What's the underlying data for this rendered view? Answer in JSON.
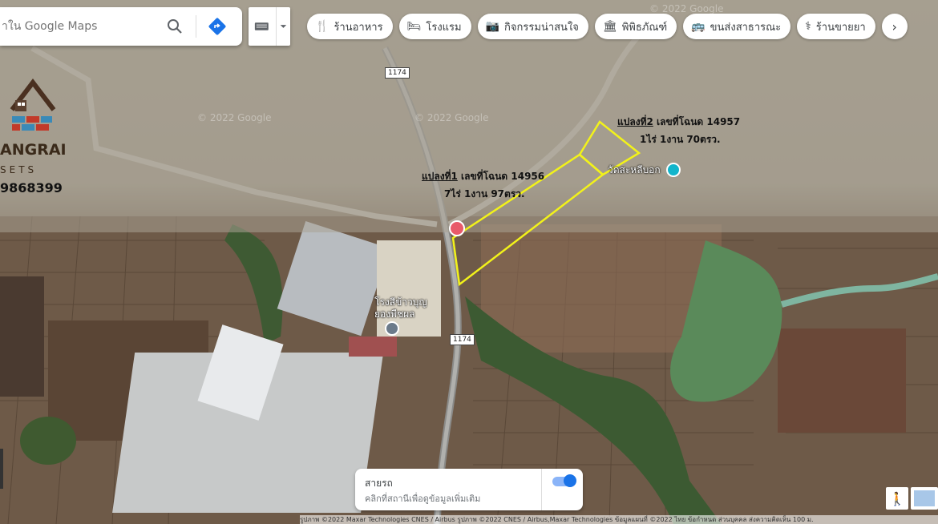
{
  "search": {
    "placeholder": "าในGoogle Maps",
    "placeholder_full": "าใน Google Maps"
  },
  "chips": [
    {
      "label": "ร้านอาหาร",
      "icon": "fork-knife-icon"
    },
    {
      "label": "โรงแรม",
      "icon": "bed-icon"
    },
    {
      "label": "กิจกรรมน่าสนใจ",
      "icon": "camera-icon"
    },
    {
      "label": "พิพิธภัณฑ์",
      "icon": "museum-icon"
    },
    {
      "label": "ขนส่งสาธารณะ",
      "icon": "bus-icon"
    },
    {
      "label": "ร้านขายยา",
      "icon": "pharmacy-icon"
    }
  ],
  "road_shields": [
    "1174",
    "1174"
  ],
  "watermarks": [
    "© 2022 Google",
    "© 2022 Google",
    "© 2022 Google"
  ],
  "plot1": {
    "title": "แปลงที่1",
    "deed": "เลขที่โฉนด 14956",
    "area": "7ไร่ 1งาน 97ตรว."
  },
  "plot2": {
    "title": "แปลงที่2",
    "deed": "เลขที่โฉนด 14957",
    "area": "1ไร่ 1งาน 70ตรว."
  },
  "logo": {
    "name": "ANGRAI",
    "sub": "SETS",
    "phone": "9868399"
  },
  "pois": [
    {
      "label": "วัดสะหลีบอก"
    },
    {
      "label_line1": "โรงสีข้าวบุญ",
      "label_line2": "ยองพืชผล"
    }
  ],
  "traffic": {
    "title": "สายรถ",
    "subtitle": "คลิกที่สถานีเพื่อดูข้อมูลเพิ่มเติม",
    "enabled": true
  },
  "footer": {
    "text": "รูปภาพ ©2022 Maxar Technologies CNES / Airbus รูปภาพ ©2022 CNES / Airbus,Maxar Technologies ข้อมูลแผนที่ ©2022   ไทย   ข้อกำหนด   ส่วนบุคคล   ส่งความคิดเห็น   100 ม."
  },
  "colors": {
    "plot_outline": "#f2f21a",
    "accent_blue": "#1a73e8"
  }
}
